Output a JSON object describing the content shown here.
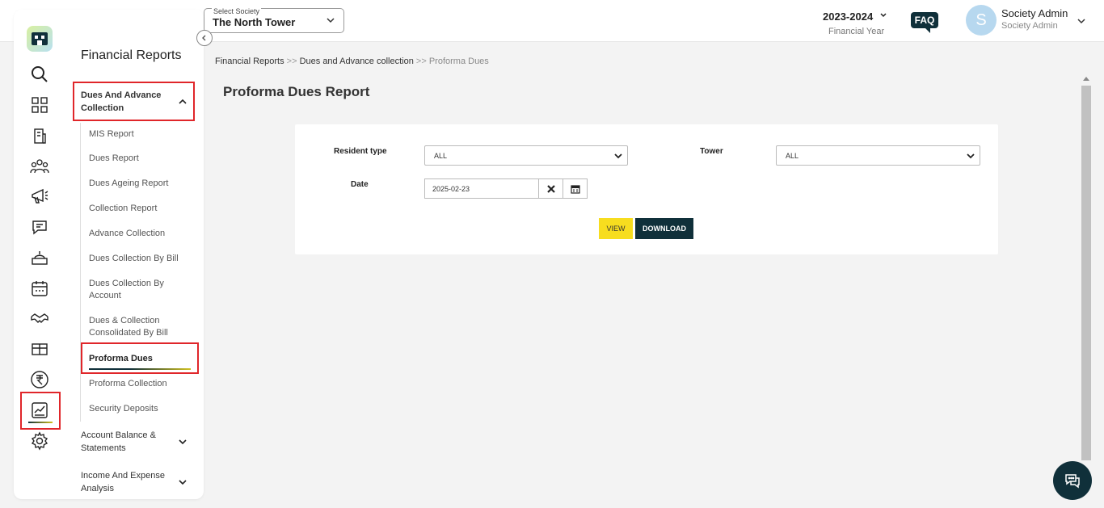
{
  "header": {
    "society_label": "Select Society",
    "society_value": "The North Tower",
    "fy_value": "2023-2024",
    "fy_label": "Financial Year",
    "faq_label": "FAQ",
    "avatar_letter": "S",
    "user_name": "Society Admin",
    "user_role": "Society Admin"
  },
  "sidebar": {
    "title": "Financial Reports",
    "section_dues": "Dues And Advance Collection",
    "sub_items": [
      "MIS Report",
      "Dues Report",
      "Dues Ageing Report",
      "Collection Report",
      "Advance Collection",
      "Dues Collection By Bill",
      "Dues Collection By Account",
      "Dues & Collection Consolidated By Bill",
      "Proforma Dues",
      "Proforma Collection",
      "Security Deposits"
    ],
    "section_account": "Account Balance & Statements",
    "section_income": "Income And Expense Analysis"
  },
  "breadcrumb": {
    "item1": "Financial Reports",
    "sep": ">>",
    "item2": "Dues and Advance collection",
    "current": "Proforma Dues"
  },
  "page": {
    "title": "Proforma Dues Report"
  },
  "form": {
    "resident_type_label": "Resident type",
    "resident_type_value": "ALL",
    "tower_label": "Tower",
    "tower_value": "ALL",
    "date_label": "Date",
    "date_value": "2025-02-23",
    "view_label": "VIEW",
    "download_label": "DOWNLOAD"
  },
  "colors": {
    "primary": "#10303a",
    "accent": "#f7dd1f",
    "highlight": "#e0262a"
  }
}
